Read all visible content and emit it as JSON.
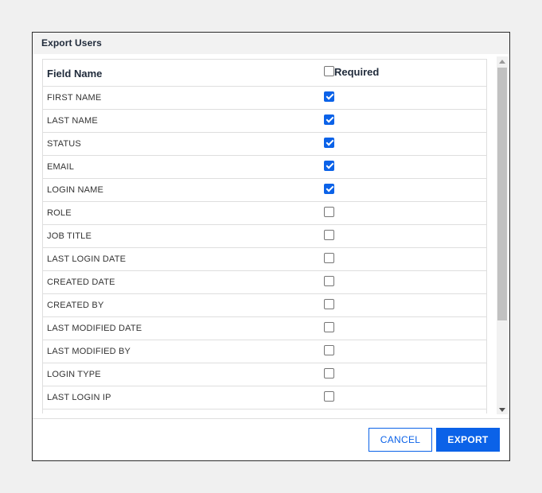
{
  "dialog": {
    "title": "Export Users",
    "columns": {
      "field_name": "Field Name",
      "required": "Required"
    },
    "required_header_checked": false,
    "rows": [
      {
        "label": "FIRST NAME",
        "checked": true
      },
      {
        "label": "LAST NAME",
        "checked": true
      },
      {
        "label": "STATUS",
        "checked": true
      },
      {
        "label": "EMAIL",
        "checked": true
      },
      {
        "label": "LOGIN NAME",
        "checked": true
      },
      {
        "label": "ROLE",
        "checked": false
      },
      {
        "label": "JOB TITLE",
        "checked": false
      },
      {
        "label": "LAST LOGIN DATE",
        "checked": false
      },
      {
        "label": "CREATED DATE",
        "checked": false
      },
      {
        "label": "CREATED BY",
        "checked": false
      },
      {
        "label": "LAST MODIFIED DATE",
        "checked": false
      },
      {
        "label": "LAST MODIFIED BY",
        "checked": false
      },
      {
        "label": "LOGIN TYPE",
        "checked": false
      },
      {
        "label": "LAST LOGIN IP",
        "checked": false
      }
    ],
    "buttons": {
      "cancel": "CANCEL",
      "export": "EXPORT"
    }
  },
  "colors": {
    "accent": "#0b62e8",
    "header_bg": "#f2f2f2",
    "page_bg": "#f0f0f0"
  },
  "icons": {
    "scroll_up": "chevron-up-icon",
    "scroll_down": "chevron-down-icon",
    "checkbox": "checkbox-icon"
  }
}
